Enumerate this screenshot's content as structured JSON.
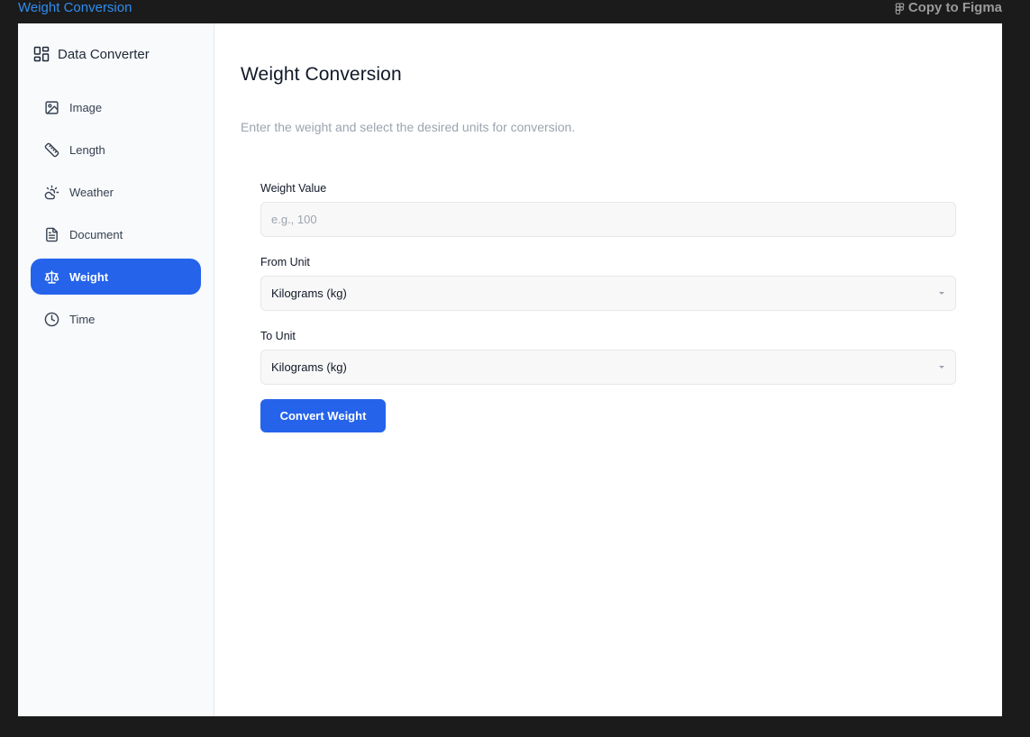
{
  "topbar": {
    "title": "Weight Conversion",
    "figma_label": "Copy to Figma"
  },
  "sidebar": {
    "brand": "Data Converter",
    "items": [
      {
        "label": "Image",
        "icon": "image-icon",
        "active": false
      },
      {
        "label": "Length",
        "icon": "ruler-icon",
        "active": false
      },
      {
        "label": "Weather",
        "icon": "cloud-sun-icon",
        "active": false
      },
      {
        "label": "Document",
        "icon": "file-text-icon",
        "active": false
      },
      {
        "label": "Weight",
        "icon": "scale-icon",
        "active": true
      },
      {
        "label": "Time",
        "icon": "clock-icon",
        "active": false
      }
    ]
  },
  "main": {
    "title": "Weight Conversion",
    "subtitle": "Enter the weight and select the desired units for conversion.",
    "weight_label": "Weight Value",
    "weight_placeholder": "e.g., 100",
    "from_label": "From Unit",
    "from_value": "Kilograms (kg)",
    "to_label": "To Unit",
    "to_value": "Kilograms (kg)",
    "convert_label": "Convert Weight"
  },
  "colors": {
    "accent": "#2563eb",
    "link": "#2f8df0",
    "backdrop": "#1b1b1b"
  }
}
